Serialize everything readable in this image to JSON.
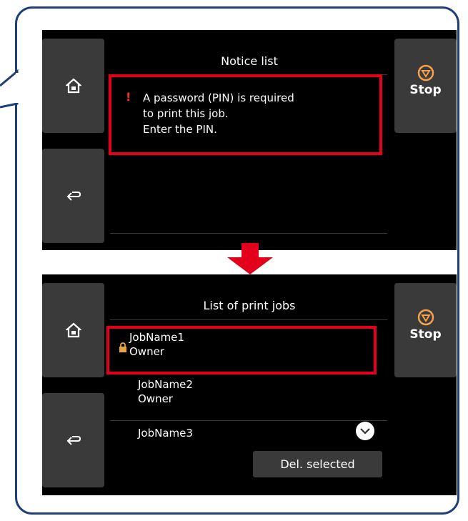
{
  "colors": {
    "callout_border": "#1f3f78",
    "highlight_red": "#e3001b",
    "screen_bg": "#000000",
    "button_bg": "#3a3a3a",
    "stop_orange": "#f7a04a",
    "lock_gold": "#e8a33a"
  },
  "top_screen": {
    "title": "Notice list",
    "notice_mark": "!",
    "notice_text": "A password (PIN) is required\nto print this job.\nEnter the PIN.",
    "stop_label": "Stop",
    "icons": [
      "home-icon",
      "back-arrow-icon",
      "stop-icon"
    ]
  },
  "bottom_screen": {
    "title": "List of print jobs",
    "stop_label": "Stop",
    "jobs": [
      {
        "name": "JobName1",
        "owner": "Owner",
        "locked": true
      },
      {
        "name": "JobName2",
        "owner": "Owner",
        "locked": false
      },
      {
        "name": "JobName3",
        "owner": "",
        "locked": false
      }
    ],
    "del_selected_label": "Del. selected",
    "icons": [
      "home-icon",
      "back-arrow-icon",
      "stop-icon",
      "lock-icon",
      "chevron-down-icon"
    ]
  }
}
